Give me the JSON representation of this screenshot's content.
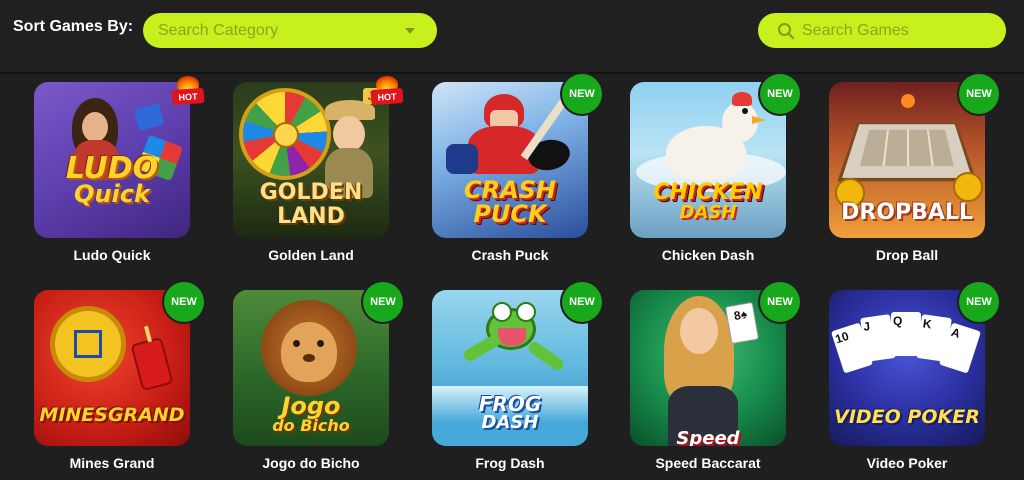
{
  "header": {
    "sort_label": "Sort Games By:",
    "category_placeholder": "Search Category",
    "search_placeholder": "Search Games"
  },
  "colors": {
    "accent": "#c6f11d",
    "background": "#1f1f1f",
    "new_badge": "#18a81b",
    "hot_badge": "#e0141c"
  },
  "games": [
    {
      "title": "Ludo Quick",
      "badge": "HOT",
      "logo_line1": "LUDO",
      "logo_line2": "Quick"
    },
    {
      "title": "Golden Land",
      "badge": "HOT",
      "logo_line1": "GOLDEN",
      "logo_line2": "LAND"
    },
    {
      "title": "Crash Puck",
      "badge": "NEW",
      "logo_line1": "CRASH",
      "logo_line2": "PUCK"
    },
    {
      "title": "Chicken Dash",
      "badge": "NEW",
      "logo_line1": "CHICKEN",
      "logo_line2": "DASH"
    },
    {
      "title": "Drop Ball",
      "badge": "NEW",
      "logo_line1": "DROPBALL",
      "logo_line2": ""
    },
    {
      "title": "Mines Grand",
      "badge": "NEW",
      "logo_line1": "MINESGRAND",
      "logo_line2": ""
    },
    {
      "title": "Jogo do Bicho",
      "badge": "NEW",
      "logo_line1": "Jogo",
      "logo_line2": "do Bicho"
    },
    {
      "title": "Frog Dash",
      "badge": "NEW",
      "logo_line1": "FROG",
      "logo_line2": "DASH"
    },
    {
      "title": "Speed Baccarat",
      "badge": "NEW",
      "logo_line1": "Speed",
      "logo_line2": ""
    },
    {
      "title": "Video Poker",
      "badge": "NEW",
      "logo_line1": "VIDEO POKER",
      "logo_line2": ""
    }
  ]
}
